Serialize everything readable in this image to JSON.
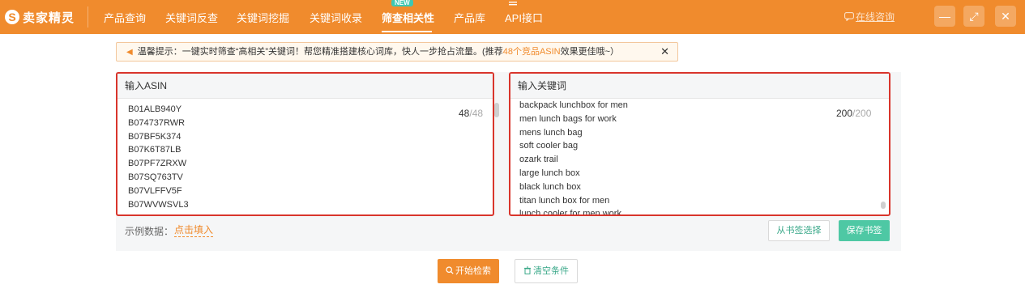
{
  "app": {
    "logo_text": "卖家精灵",
    "logo_mark": "S"
  },
  "nav": {
    "items": [
      {
        "label": "产品查询"
      },
      {
        "label": "关键词反查"
      },
      {
        "label": "关键词挖掘"
      },
      {
        "label": "关键词收录"
      },
      {
        "label": "筛查相关性"
      },
      {
        "label": "产品库"
      },
      {
        "label": "API接口"
      }
    ],
    "new_badge": "NEW",
    "consult_label": "在线咨询"
  },
  "window": {
    "minimize_icon": "—",
    "maximize_icon": "⤢",
    "close_icon": "✕"
  },
  "tip": {
    "prefix": "温馨提示：一键实时筛查“高相关”关键词！帮您精准搭建核心词库，快人一步抢占流量。(推荐",
    "highlight": "48个竞品ASIN",
    "suffix": "效果更佳哦~）",
    "close": "✕"
  },
  "asin_box": {
    "title": "输入ASIN",
    "items": [
      "B01ALB940Y",
      "B074737RWR",
      "B07BF5K374",
      "B07K6T87LB",
      "B07PF7ZRXW",
      "B07SQ763TV",
      "B07VLFFV5F",
      "B07WVWSVL3"
    ],
    "count": "48",
    "max": "/48"
  },
  "keyword_box": {
    "title": "输入关键词",
    "items": [
      "backpack lunchbox for men",
      "men lunch bags for work",
      "mens lunch bag",
      "soft cooler bag",
      "ozark trail",
      "large lunch box",
      "black lunch box",
      "titan lunch box for men",
      "lunch cooler for men work"
    ],
    "count": "200",
    "max": "/200"
  },
  "example": {
    "label": "示例数据：",
    "link": "点击填入"
  },
  "buttons": {
    "from_bookmark": "从书签选择",
    "save_bookmark": "保存书签",
    "start_search": "开始检索",
    "clear": "清空条件"
  },
  "colors": {
    "brand": "#f08b2d",
    "green": "#4ec8a4",
    "highlight_border": "#d9352c"
  }
}
